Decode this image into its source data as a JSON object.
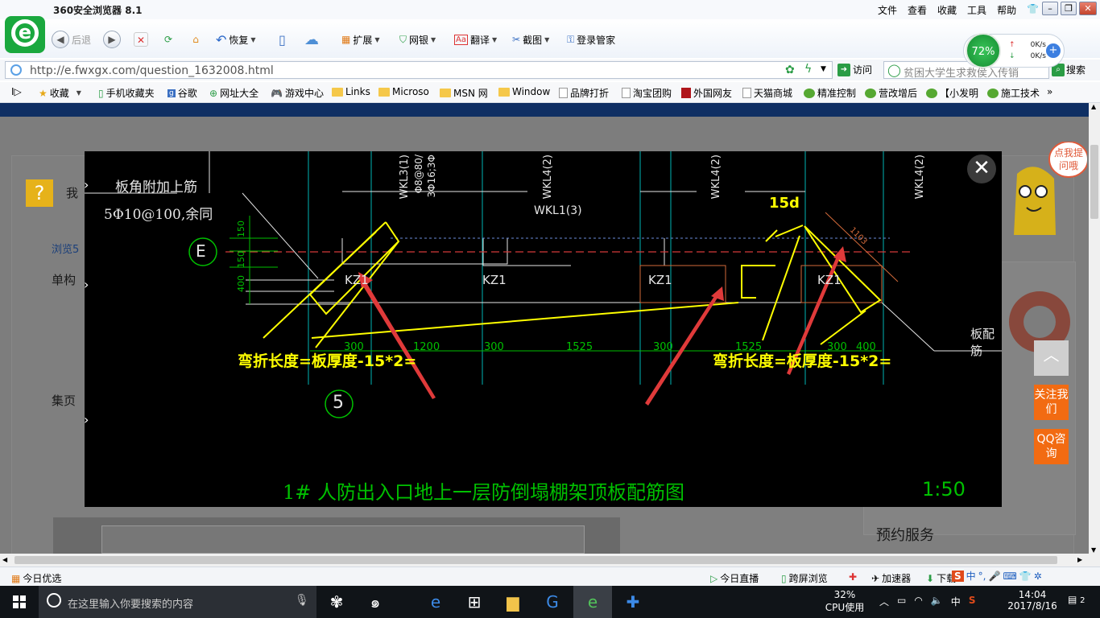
{
  "browser": {
    "title": "360安全浏览器 8.1",
    "menu": [
      "文件",
      "查看",
      "收藏",
      "工具",
      "帮助"
    ]
  },
  "toolbar": {
    "back": "后退",
    "restore": "恢复",
    "extend": "扩展",
    "bank": "网银",
    "translate": "翻译",
    "screenshot": "截图",
    "login": "登录管家"
  },
  "speed": {
    "percent": "72%",
    "up": "0K/s",
    "down": "0K/s"
  },
  "address": {
    "url": "http://e.fwxgx.com/question_1632008.html",
    "visit": "访问",
    "search_placeholder": "贫困大学生求救侯入传销",
    "search_btn": "搜索"
  },
  "favorites": [
    "收藏",
    "手机收藏夹",
    "谷歌",
    "网址大全",
    "游戏中心",
    "Links",
    "Microso",
    "MSN 网",
    "Window",
    "品牌打折",
    "淘宝团购",
    "外国网友",
    "天猫商城",
    "精准控制",
    "营改增后",
    "【小发明",
    "施工技术"
  ],
  "page_bg": {
    "left_labels": [
      "我",
      "浏览5",
      "单构",
      "集页"
    ],
    "right_service": "预约服务",
    "mascot_text": "点我提问哦"
  },
  "drawing": {
    "title_cad": "1# 人防出入口地上一层防倒塌棚架顶板配筋图",
    "scale": "1:50",
    "note_rebar": "板角附加上筋",
    "note_spec": "5Φ10@100,余同",
    "axis_e": "E",
    "axis_5": "5",
    "kz_labels": [
      "KZ1",
      "KZ1",
      "KZ1",
      "KZ1"
    ],
    "wkl_labels": [
      "WKL3(1)",
      "WKL4(2)",
      "WKL4(2)",
      "WKL4(2)"
    ],
    "wkl_sub": "Φ8@80/",
    "wkl_sub2": "3Φ16;3Φ",
    "wkl_mid": "WKL1(3)",
    "dims_bottom": [
      "300",
      "1200",
      "300",
      "1525",
      "300",
      "1525",
      "300",
      "400"
    ],
    "dims_left": [
      "150",
      "150",
      "400"
    ],
    "annotation_15d": "15d",
    "annotation_left": "弯折长度=板厚度-15*2=",
    "annotation_right": "弯折长度=板厚度-15*2=",
    "slab_rebar": "板配筋",
    "dim_diag": "1103"
  },
  "side": {
    "follow": "关注我们",
    "qq": "QQ咨询"
  },
  "status": {
    "today": "今日优选",
    "live": "今日直播",
    "cross": "跨屏浏览",
    "accel": "加速器",
    "download": "下载"
  },
  "taskbar": {
    "search": "在这里输入你要搜索的内容",
    "cpu_pct": "32%",
    "cpu_label": "CPU使用",
    "ime": "中",
    "time": "14:04",
    "date": "2017/8/16",
    "notif": "2"
  },
  "colors": {
    "accent": "#1aa83e",
    "annotation": "#ffff00",
    "arrow": "#e03a3a",
    "cad_green": "#00e000",
    "side_orange": "#f26b12"
  }
}
